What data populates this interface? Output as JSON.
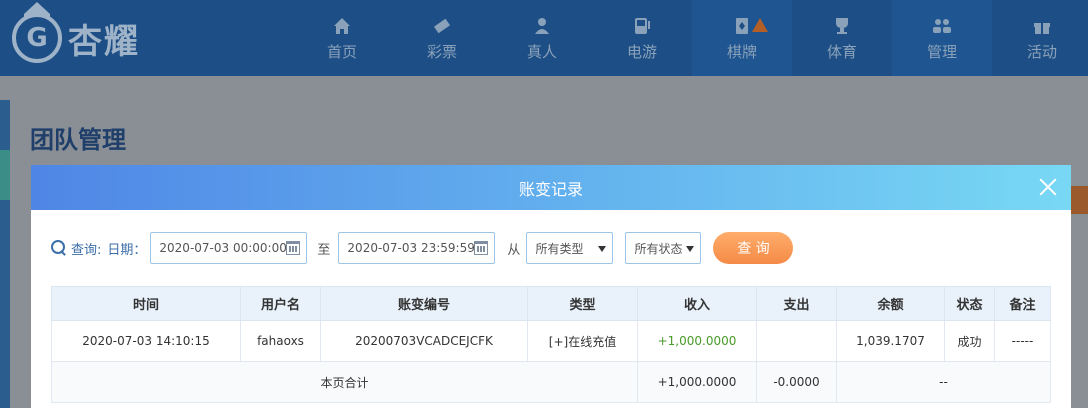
{
  "brand": {
    "logo_text": "杏耀",
    "logo_mark": "G"
  },
  "nav": [
    {
      "label": "首页",
      "icon": "home-icon"
    },
    {
      "label": "彩票",
      "icon": "ticket-icon"
    },
    {
      "label": "真人",
      "icon": "person-icon"
    },
    {
      "label": "电游",
      "icon": "arcade-icon"
    },
    {
      "label": "棋牌",
      "icon": "cards-icon"
    },
    {
      "label": "体育",
      "icon": "trophy-icon"
    },
    {
      "label": "管理",
      "icon": "users-icon"
    },
    {
      "label": "活动",
      "icon": "gift-icon"
    }
  ],
  "page": {
    "title": "团队管理"
  },
  "modal": {
    "title": "账变记录",
    "filters": {
      "search_label": "查询:",
      "date_label": "日期：",
      "start_date": "2020-07-03 00:00:00",
      "to_label": "至",
      "end_date": "2020-07-03 23:59:59",
      "from_label": "从",
      "type_select": "所有类型",
      "status_select": "所有状态",
      "search_button": "查 询"
    },
    "table": {
      "columns": [
        "时间",
        "用户名",
        "账变编号",
        "类型",
        "收入",
        "支出",
        "余额",
        "状态",
        "备注"
      ],
      "rows": [
        [
          "2020-07-03 14:10:15",
          "fahaoxs",
          "20200703VCADCEJCFK",
          "[+]在线充值",
          "+1,000.0000",
          "",
          "1,039.1707",
          "成功",
          "-----"
        ]
      ],
      "total": {
        "label": "本页合计",
        "income": "+1,000.0000",
        "expense": "-0.0000",
        "balance": "--"
      }
    }
  },
  "colors": {
    "nav_bg": "#1d4f86",
    "header_gradient_start": "#4f86e6",
    "header_gradient_end": "#78d8f4",
    "button": "#f58a47",
    "income": "#4a9a2a"
  }
}
